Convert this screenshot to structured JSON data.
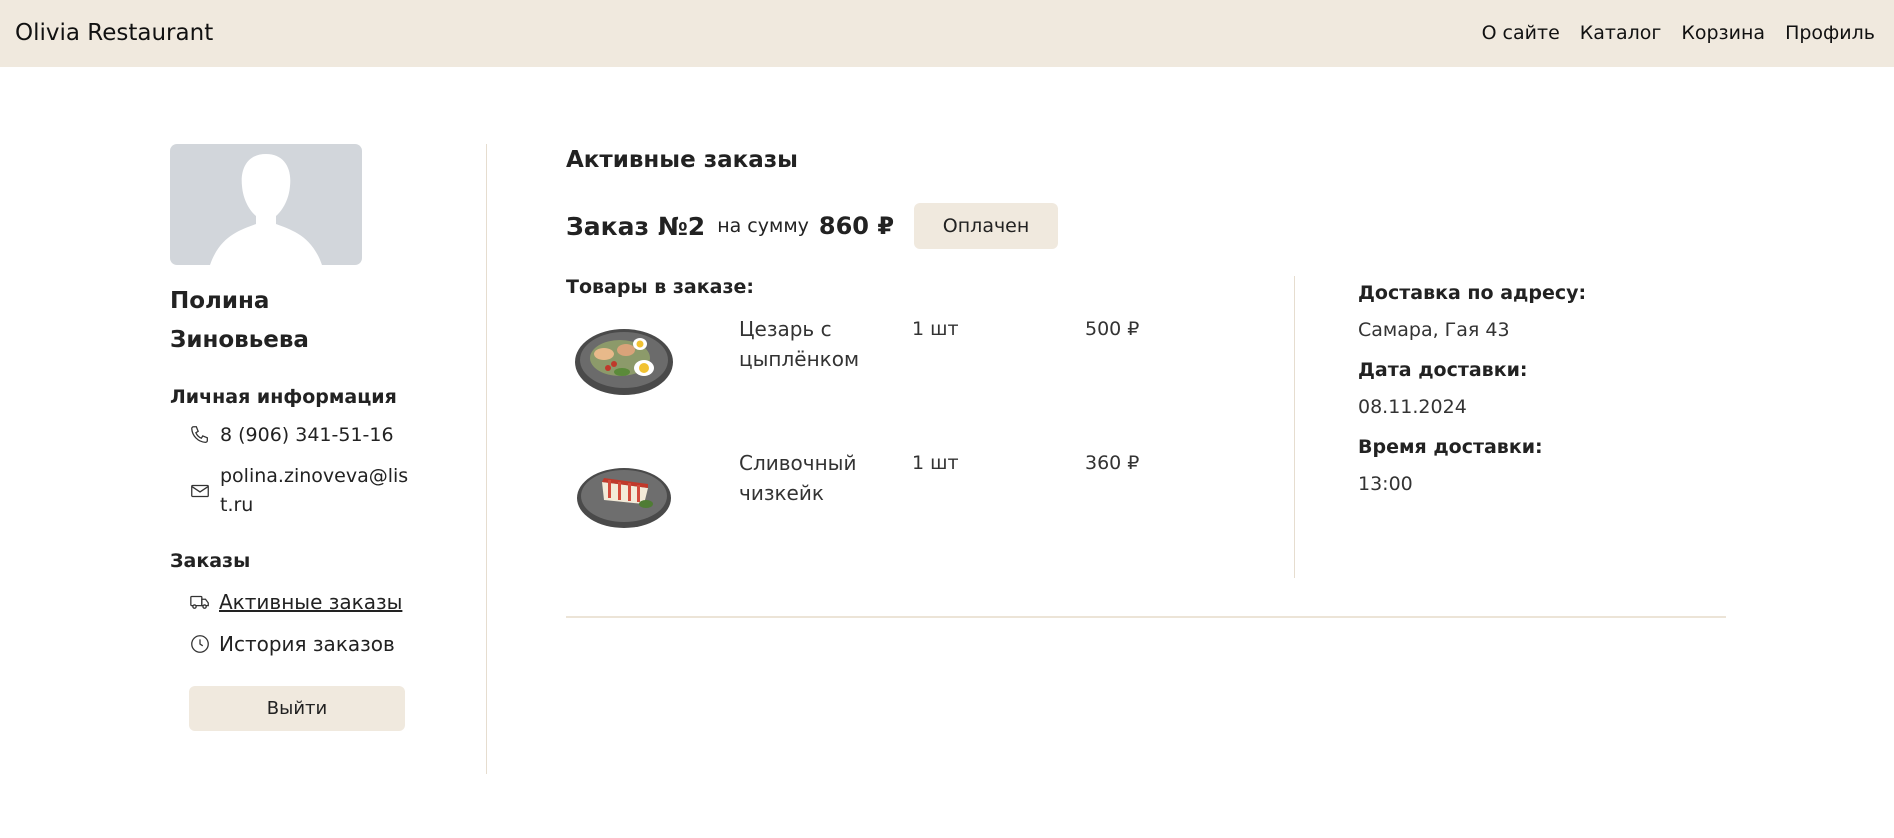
{
  "navbar": {
    "brand": "Olivia Restaurant",
    "links": [
      "О сайте",
      "Каталог",
      "Корзина",
      "Профиль"
    ]
  },
  "sidebar": {
    "first_name": "Полина",
    "last_name": "Зиновьева",
    "personal_title": "Личная информация",
    "phone": "8 (906) 341-51-16",
    "email": "polina.zinoveva@list.ru",
    "orders_title": "Заказы",
    "active_orders": "Активные заказы",
    "order_history": "История заказов",
    "logout": "Выйти"
  },
  "main": {
    "title": "Активные заказы",
    "order": {
      "number": "Заказ №2",
      "sum_label": "на сумму",
      "sum": "860 ₽",
      "status": "Оплачен",
      "goods_title": "Товары в заказе:",
      "items": [
        {
          "name": "Цезарь с цыплёнком",
          "qty": "1 шт",
          "price": "500 ₽",
          "image": "caesar-salad"
        },
        {
          "name": "Сливочный чизкейк",
          "qty": "1 шт",
          "price": "360 ₽",
          "image": "cheesecake"
        }
      ],
      "delivery": {
        "address_label": "Доставка по адресу:",
        "address": "Самара, Гая 43",
        "date_label": "Дата доставки:",
        "date": "08.11.2024",
        "time_label": "Время доставки:",
        "time": "13:00"
      }
    }
  },
  "colors": {
    "navbar_bg": "#f0e9de",
    "button_bg": "#f0e9de",
    "avatar_bg": "#d2d6db",
    "divider": "#e6ddcf"
  }
}
